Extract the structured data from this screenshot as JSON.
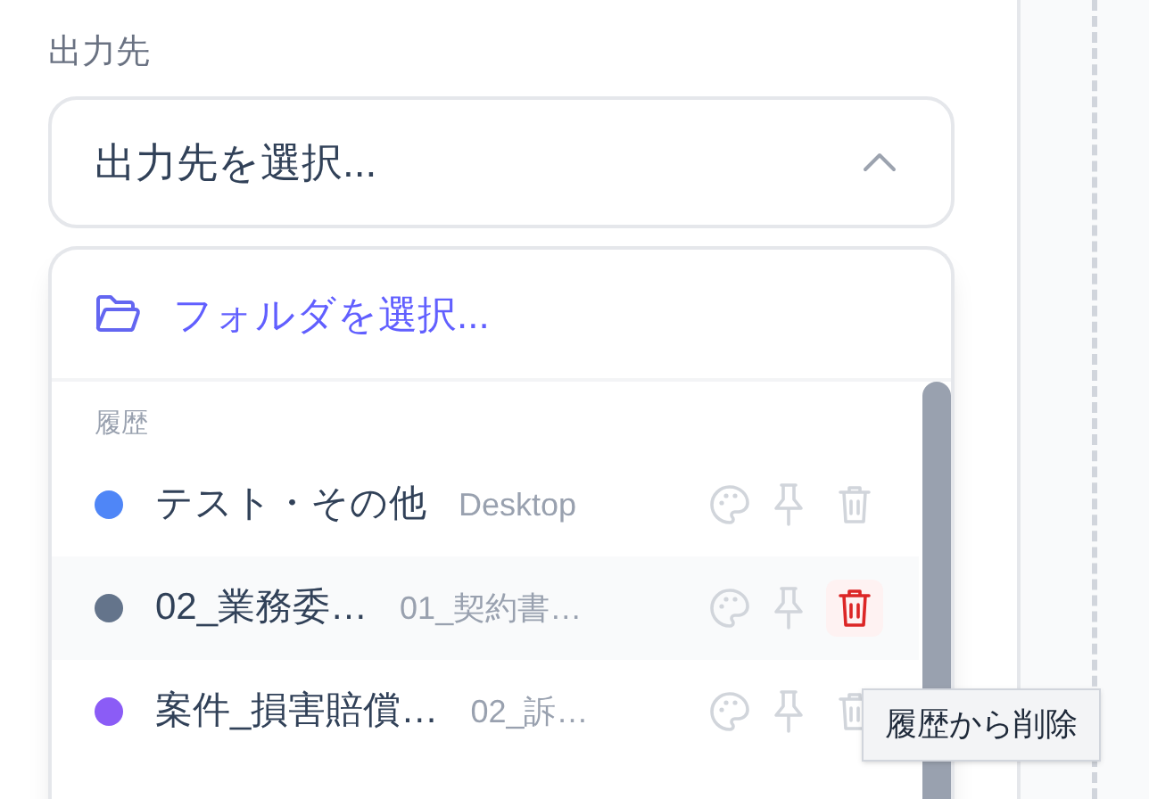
{
  "field_label": "出力先",
  "select": {
    "placeholder": "出力先を選択...",
    "expanded": true
  },
  "dropdown": {
    "folder_action": "フォルダを選択...",
    "history_heading": "履歴",
    "history": [
      {
        "name": "テスト・その他",
        "location": "Desktop",
        "color": "#4f86f7",
        "hovered": false
      },
      {
        "name": "02_業務委…",
        "location": "01_契約書…",
        "color": "#64748b",
        "hovered": true
      },
      {
        "name": "案件_損害賠償…",
        "location": "02_訴…",
        "color": "#8b5cf6",
        "hovered": false
      }
    ]
  },
  "tooltip": "履歴から削除"
}
